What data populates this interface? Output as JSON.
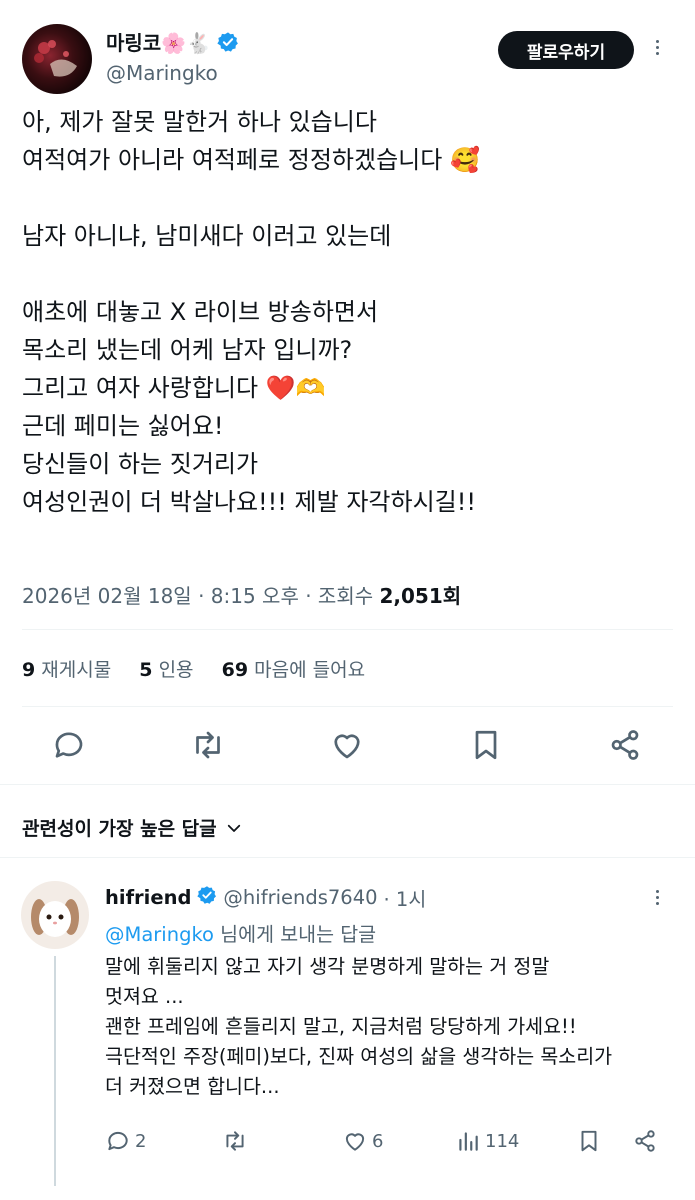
{
  "author": {
    "name": "마링코🌸🐇",
    "handle": "@Maringko",
    "follow_label": "팔로우하기"
  },
  "tweet": {
    "text": "아, 제가 잘못 말한거 하나 있습니다\n여적여가 아니라 여적페로 정정하겠습니다 🥰\n\n남자 아니냐, 남미새다 이러고 있는데\n\n애초에 대놓고 X 라이브 방송하면서\n목소리 냈는데 어케 남자 입니까?\n그리고 여자 사랑합니다 ❤️🫶\n근데 페미는 싫어요!\n당신들이 하는 짓거리가\n여성인권이 더 박살나요!!! 제발 자각하시길!!",
    "meta_date": "2026년 02월 18일 · 8:15 오후 · 조회수 ",
    "meta_views": "2,051회"
  },
  "stats": {
    "retweets_count": "9",
    "retweets_label": "재게시물",
    "quotes_count": "5",
    "quotes_label": "인용",
    "likes_count": "69",
    "likes_label": "마음에 들어요"
  },
  "sort": {
    "label": "관련성이 가장 높은 답글"
  },
  "reply": {
    "name": "hifriend",
    "handle": "@hifriends7640",
    "time": "· 1시",
    "replying_to_handle": "@Maringko",
    "replying_to_suffix": " 님에게 보내는 답글",
    "text": "말에 휘둘리지 않고 자기 생각 분명하게 말하는 거 정말\n멋져요 ...\n괜한 프레임에 흔들리지 말고, 지금처럼 당당하게 가세요!!\n극단적인 주장(페미)보다, 진짜 여성의 삶을 생각하는 목소리가\n더 커졌으면 합니다...",
    "replies": "2",
    "likes": "6",
    "views": "114"
  },
  "colors": {
    "accent": "#1d9bf0",
    "text": "#0f1419",
    "muted": "#536471",
    "divider": "#eff3f4"
  },
  "icons": [
    "verified-badge-icon",
    "more-icon",
    "reply-icon",
    "retweet-icon",
    "like-icon",
    "bookmark-icon",
    "share-icon",
    "chevron-down-icon",
    "views-icon"
  ]
}
